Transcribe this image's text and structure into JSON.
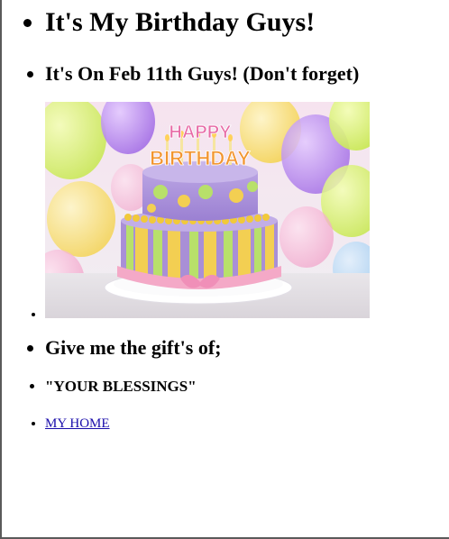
{
  "heading": "It's My Birthday Guys!",
  "date_line": "It's On Feb 11th Guys! (Don't forget)",
  "cake_image": {
    "topper_top": "HAPPY",
    "topper_bottom": "BIRTHDAY"
  },
  "gift_line": "Give me the gift's of;",
  "blessings": "\"YOUR BLESSINGS\"",
  "home_link": "MY HOME",
  "colors": {
    "link": "#1a0dab",
    "frame": "#5a5a5a",
    "cake_purple": "#a98fd6",
    "cake_yellow": "#f3cf52",
    "ribbon_pink": "#f4a9c7"
  }
}
